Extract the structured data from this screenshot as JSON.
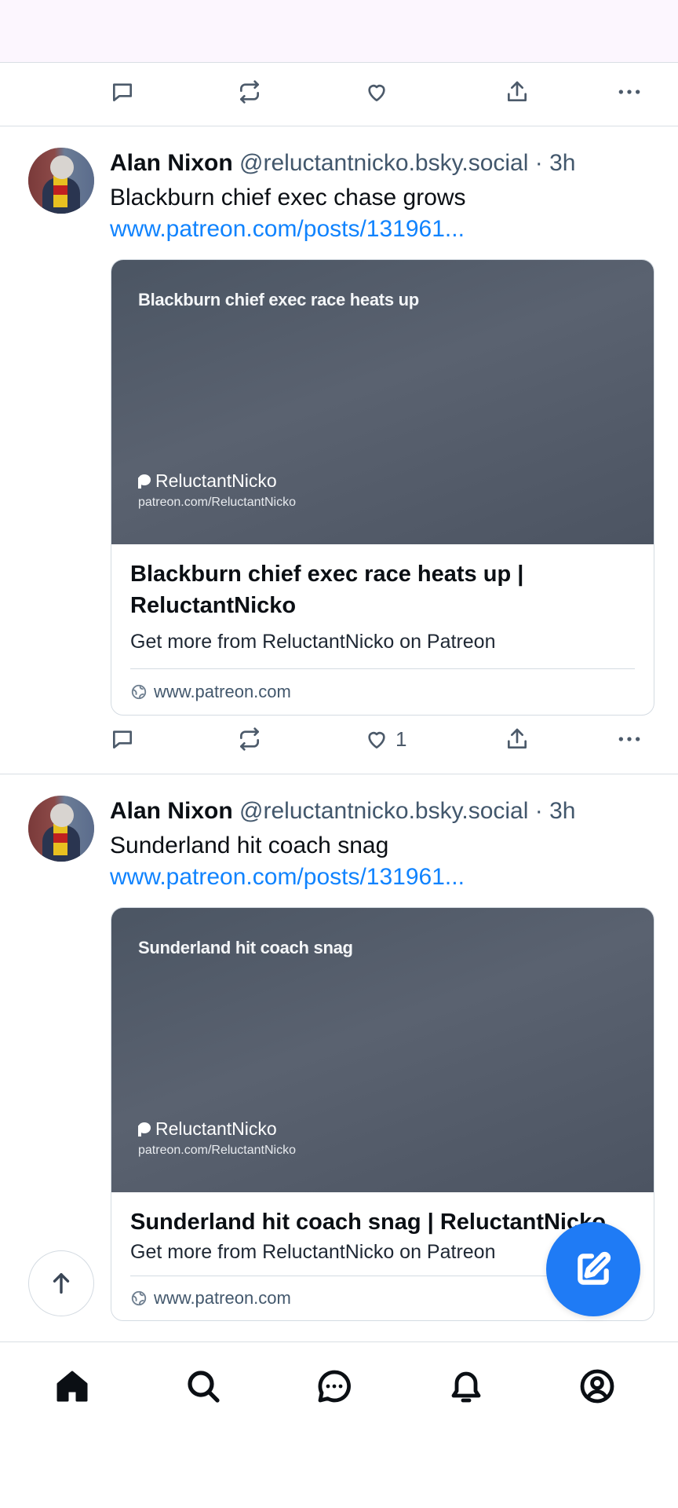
{
  "colors": {
    "accent": "#1083fe",
    "fab": "#1f7bf5",
    "muted_text": "#42576c",
    "icon": "#4c5a6a"
  },
  "top_action_row": {
    "reply_icon": "reply-icon",
    "repost_icon": "repost-icon",
    "like_icon": "heart-icon",
    "share_icon": "share-icon",
    "more_icon": "more-icon"
  },
  "posts": [
    {
      "author": "Alan Nixon",
      "handle": "@reluctantnicko.bsky.social",
      "time_sep": " · ",
      "time": "3h",
      "text": "Blackburn chief exec chase grows",
      "link": "www.patreon.com/posts/131961...",
      "card": {
        "image_title": "Blackburn chief exec race heats up",
        "image_brand": "ReluctantNicko",
        "image_url": "patreon.com/ReluctantNicko",
        "title": "Blackburn chief exec race heats up | ReluctantNicko",
        "description": "Get more from ReluctantNicko on Patreon",
        "domain": "www.patreon.com"
      },
      "like_count": "1"
    },
    {
      "author": "Alan Nixon",
      "handle": "@reluctantnicko.bsky.social",
      "time_sep": " · ",
      "time": "3h",
      "text": "Sunderland hit coach snag",
      "link": "www.patreon.com/posts/131961...",
      "card": {
        "image_title": "Sunderland hit coach snag",
        "image_brand": "ReluctantNicko",
        "image_url": "patreon.com/ReluctantNicko",
        "title": "Sunderland hit coach snag  | ReluctantNicko",
        "description": "Get more from ReluctantNicko on Patreon",
        "domain": "www.patreon.com"
      }
    }
  ],
  "bottom_nav": {
    "items": [
      "home-icon",
      "search-icon",
      "chat-icon",
      "bell-icon",
      "profile-icon"
    ]
  }
}
